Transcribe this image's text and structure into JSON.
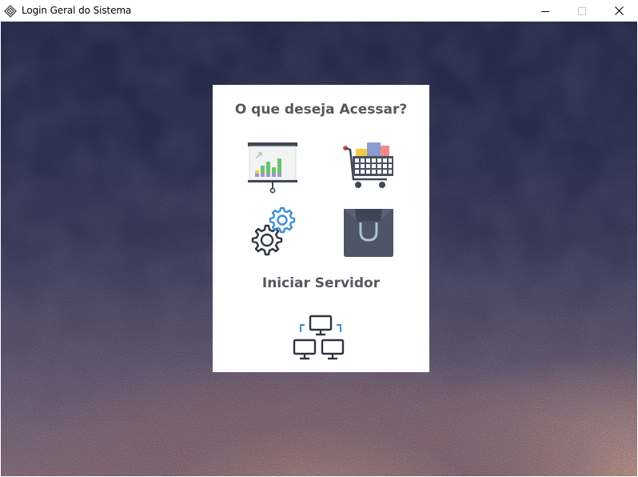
{
  "window": {
    "title": "Login Geral do Sistema",
    "icon": "app-diamond-icon",
    "controls": [
      "minimize-icon",
      "maximize-icon",
      "close-icon"
    ]
  },
  "menu": {
    "heading": "O que deseja Acessar?",
    "options": [
      {
        "name": "reports",
        "icon": "presentation-chart-icon"
      },
      {
        "name": "shopping",
        "icon": "shopping-cart-icon"
      },
      {
        "name": "settings",
        "icon": "gears-icon"
      },
      {
        "name": "store",
        "icon": "shopping-bag-icon"
      }
    ]
  },
  "server": {
    "heading": "Iniciar Servidor",
    "icon": "network-computers-icon"
  },
  "colors": {
    "heading_text": "#55585e",
    "accent_blue": "#3a8fd6",
    "card_bg": "#ffffff"
  }
}
